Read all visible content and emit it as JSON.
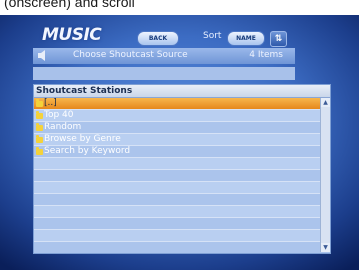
{
  "caption": "(onscreen) and scroll",
  "app": {
    "title": "MUSIC"
  },
  "toolbar": {
    "back_label": "BACK",
    "sort_label": "Sort",
    "sort_value": "NAME",
    "sort_direction_symbol": "⇅"
  },
  "header": {
    "title": "Choose Shoutcast Source",
    "item_count": "4 Items"
  },
  "list": {
    "header": "Shoutcast Stations",
    "items": [
      {
        "label": "[..]",
        "selected": true
      },
      {
        "label": "Top 40",
        "selected": false
      },
      {
        "label": "Random",
        "selected": false
      },
      {
        "label": "Browse by Genre",
        "selected": false
      },
      {
        "label": "Search by Keyword",
        "selected": false
      }
    ],
    "empty_rows": 8
  },
  "icons": {
    "folder": "folder-icon",
    "source": "speaker-icon",
    "scroll_up": "scroll-up-arrow-icon",
    "scroll_down": "scroll-down-arrow-icon"
  },
  "colors": {
    "selection": "#f0a030",
    "folder": "#f4d23a"
  }
}
